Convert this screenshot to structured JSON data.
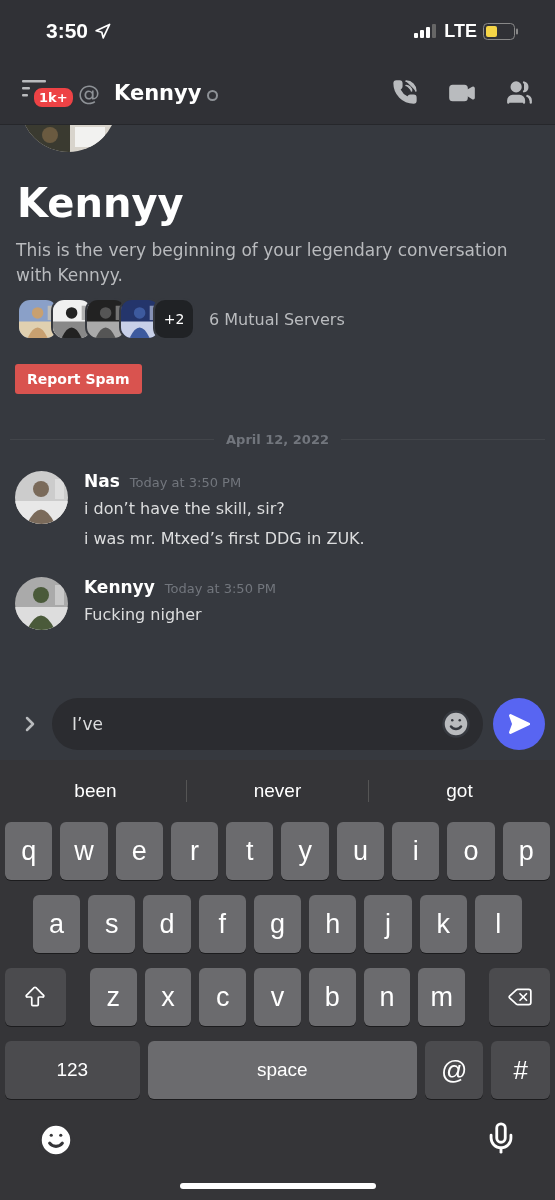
{
  "status_bar": {
    "time": "3:50",
    "network": "LTE"
  },
  "header": {
    "badge": "1k+",
    "at_sign": "@",
    "title": "Kennyy"
  },
  "intro": {
    "name": "Kennyy",
    "description": "This is the very beginning of your legendary conversation with Kennyy.",
    "more_servers": "+2",
    "mutual_servers": "6 Mutual Servers",
    "report_button": "Report Spam"
  },
  "date_divider": "April 12, 2022",
  "messages": [
    {
      "author": "Nas",
      "time": "Today at 3:50 PM",
      "lines": [
        "i don’t have the skill, sir?",
        "i was mr. Mtxed’s first DDG in ZUK."
      ]
    },
    {
      "author": "Kennyy",
      "time": "Today at 3:50 PM",
      "lines": [
        "Fucking nigher"
      ]
    }
  ],
  "composer": {
    "value": "I’ve"
  },
  "suggestions": [
    "been",
    "never",
    "got"
  ],
  "keyboard": {
    "rows": [
      [
        "q",
        "w",
        "e",
        "r",
        "t",
        "y",
        "u",
        "i",
        "o",
        "p"
      ],
      [
        "a",
        "s",
        "d",
        "f",
        "g",
        "h",
        "j",
        "k",
        "l"
      ],
      [
        "z",
        "x",
        "c",
        "v",
        "b",
        "n",
        "m"
      ]
    ],
    "bottom_row": [
      {
        "kind": "mode",
        "label": "123"
      },
      {
        "kind": "space",
        "label": "space"
      },
      {
        "kind": "symbol",
        "label": "@"
      },
      {
        "kind": "symbol",
        "label": "#"
      }
    ]
  }
}
